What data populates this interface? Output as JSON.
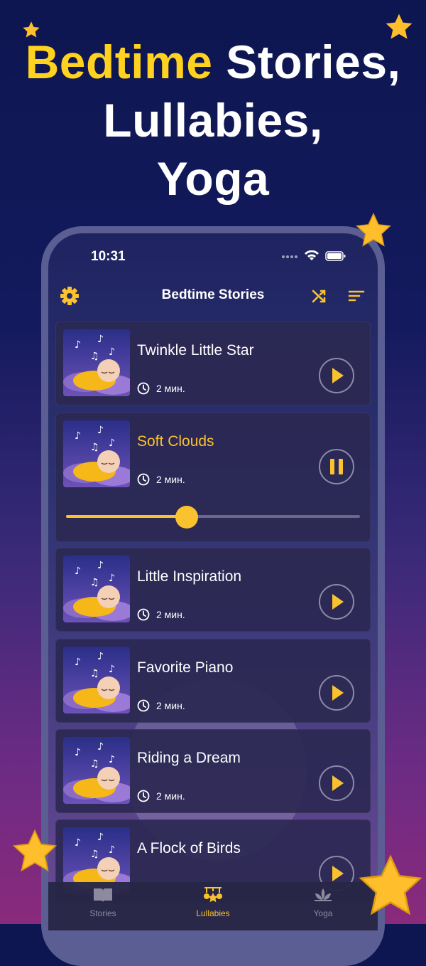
{
  "headline": {
    "highlight": "Bedtime",
    "line1_rest": " Stories,",
    "line2": "Lullabies,",
    "line3": "Yoga"
  },
  "status": {
    "time": "10:31"
  },
  "nav": {
    "title": "Bedtime Stories"
  },
  "tracks": [
    {
      "title": "Twinkle Little Star",
      "duration": "2 мин.",
      "state": "paused"
    },
    {
      "title": "Soft Clouds",
      "duration": "2 мин.",
      "state": "playing",
      "progress": 0.41
    },
    {
      "title": "Little Inspiration",
      "duration": "2 мин.",
      "state": "paused"
    },
    {
      "title": "Favorite Piano",
      "duration": "2 мин.",
      "state": "paused"
    },
    {
      "title": "Riding a Dream",
      "duration": "2 мин.",
      "state": "paused"
    },
    {
      "title": "A Flock of Birds",
      "duration": "",
      "state": "paused"
    }
  ],
  "tabs": [
    {
      "label": "Stories",
      "icon": "book-icon",
      "active": false
    },
    {
      "label": "Lullabies",
      "icon": "crib-mobile-icon",
      "active": true
    },
    {
      "label": "Yoga",
      "icon": "lotus-icon",
      "active": false
    }
  ],
  "colors": {
    "accent": "#f9c22e",
    "background_top": "#0d1650",
    "background_bottom": "#8a2a7c",
    "card": "#2b2852"
  }
}
